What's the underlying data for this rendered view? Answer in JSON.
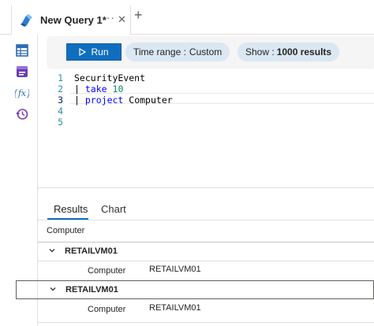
{
  "tab": {
    "title": "New Query 1*",
    "more": "···",
    "close": "✕",
    "new_tab": "+"
  },
  "sidebar": {
    "items": [
      {
        "icon": "table-icon"
      },
      {
        "icon": "saved-query-icon"
      },
      {
        "icon": "function-icon"
      },
      {
        "icon": "history-icon"
      }
    ]
  },
  "toolbar": {
    "run_label": "Run",
    "time_range_label": "Time range :",
    "time_range_value": "Custom",
    "show_label": "Show :",
    "show_value": "1000 results"
  },
  "editor": {
    "lines": [
      {
        "number": "1",
        "code": "SecurityEvent"
      },
      {
        "number": "2",
        "pipe": "|",
        "keyword": "take",
        "value": "10"
      },
      {
        "number": "3",
        "pipe": "|",
        "keyword": "project",
        "value": "Computer"
      },
      {
        "number": "4",
        "code": ""
      },
      {
        "number": "5",
        "code": ""
      }
    ]
  },
  "results": {
    "tabs": [
      "Results",
      "Chart"
    ],
    "column_header": "Computer",
    "groups": [
      {
        "label": "RETAILVM01",
        "detail_key": "Computer",
        "detail_value": "RETAILVM01"
      },
      {
        "label": "RETAILVM01",
        "detail_key": "Computer",
        "detail_value": "RETAILVM01"
      }
    ]
  },
  "colors": {
    "accent": "#106ebe",
    "pill_bg": "#dbe7f3",
    "keyword": "#0000ff",
    "number": "#09885a",
    "line_number": "#2b91af"
  }
}
